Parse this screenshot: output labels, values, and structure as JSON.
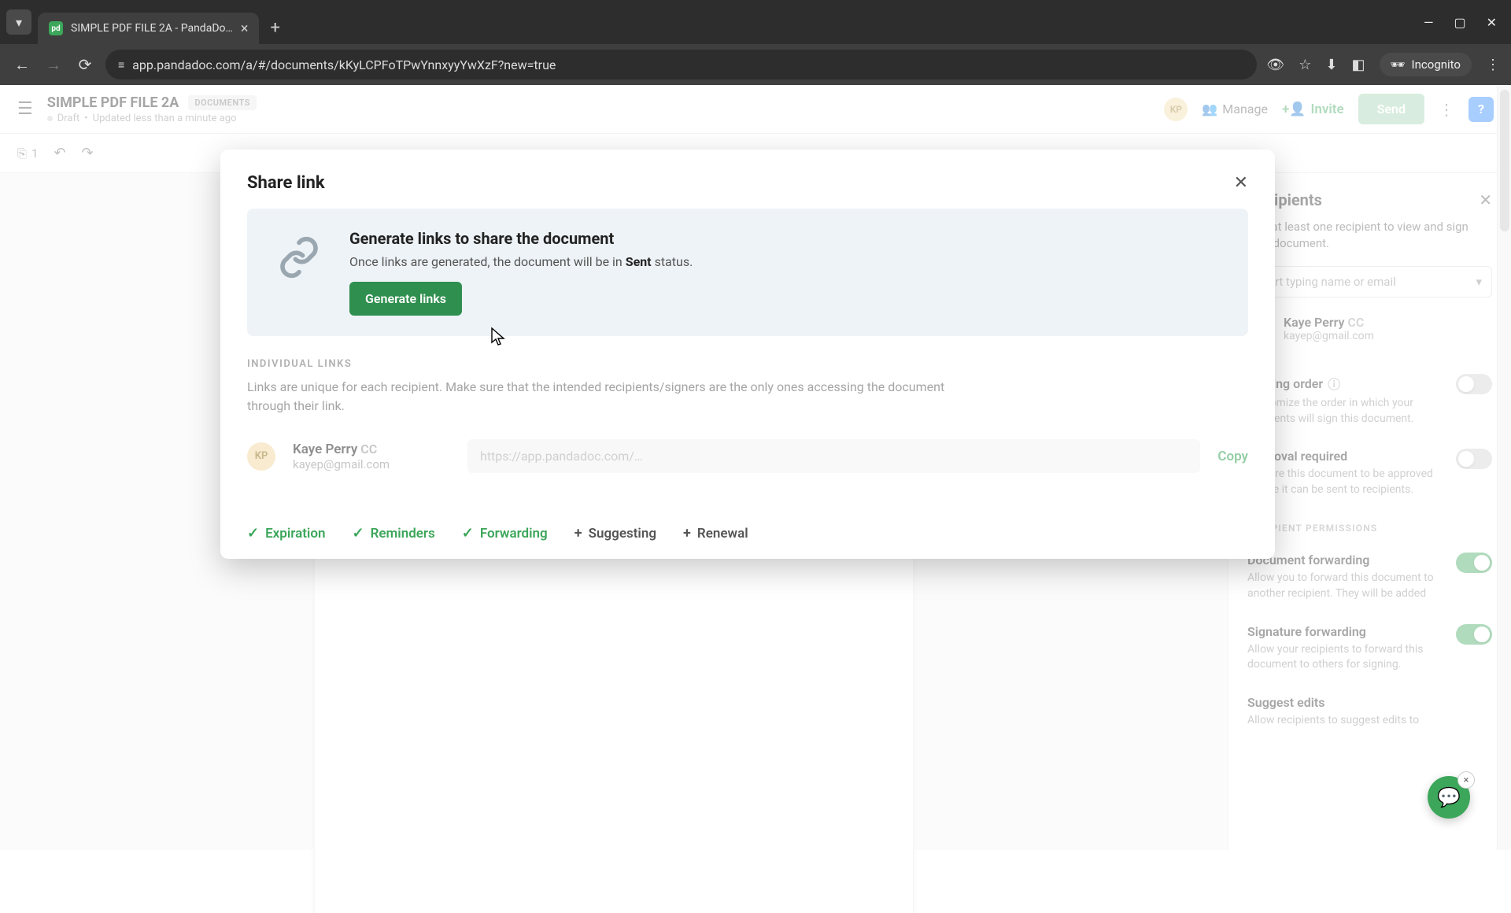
{
  "browser": {
    "tab_title": "SIMPLE PDF FILE 2A - PandaDo…",
    "url": "app.pandadoc.com/a/#/documents/kKyLCPFoTPwYnnxyyYwXzF?new=true",
    "incognito_label": "Incognito"
  },
  "header": {
    "doc_title": "SIMPLE PDF FILE 2A",
    "badge": "DOCUMENTS",
    "status": "Draft",
    "updated": "Updated less than a minute ago",
    "avatar_initials": "KP",
    "manage": "Manage",
    "invite": "Invite",
    "send": "Send"
  },
  "sec_toolbar": {
    "page_count": "1"
  },
  "right_panel": {
    "title": "Recipients",
    "desc": "Add at least one recipient to view and sign your document.",
    "placeholder": "Start typing name or email",
    "recipient": {
      "initials": "KP",
      "name": "Kaye Perry",
      "cc": "CC",
      "email": "kayep@gmail.com"
    },
    "signing_order": {
      "label": "Signing order",
      "desc": "Customize the order in which your recipients will sign this document."
    },
    "approval": {
      "label": "Approval required",
      "desc": "Require this document to be approved before it can be sent to recipients."
    },
    "permissions_header": "RECIPIENT PERMISSIONS",
    "doc_forward": {
      "label": "Document forwarding",
      "desc": "Allow you to forward this document to another recipient. They will be added"
    },
    "sig_forward": {
      "label": "Signature forwarding",
      "desc": "Allow your recipients to forward this document to others for signing."
    },
    "suggest": {
      "label": "Suggest edits",
      "desc": "Allow recipients to suggest edits to"
    }
  },
  "modal": {
    "title": "Share link",
    "heading": "Generate links to share the document",
    "sub_pre": "Once links are generated, the document will be in ",
    "sub_bold": "Sent",
    "sub_post": " status.",
    "generate_btn": "Generate links",
    "section_label": "INDIVIDUAL LINKS",
    "section_desc": "Links are unique for each recipient. Make sure that the intended recipients/signers are the only ones accessing the document through their link.",
    "link_row": {
      "initials": "KP",
      "name": "Kaye Perry",
      "cc": "CC",
      "email": "kayep@gmail.com",
      "url_placeholder": "https://app.pandadoc.com/…",
      "copy": "Copy"
    },
    "footer": {
      "expiration": "Expiration",
      "reminders": "Reminders",
      "forwarding": "Forwarding",
      "suggesting": "Suggesting",
      "renewal": "Renewal"
    }
  }
}
